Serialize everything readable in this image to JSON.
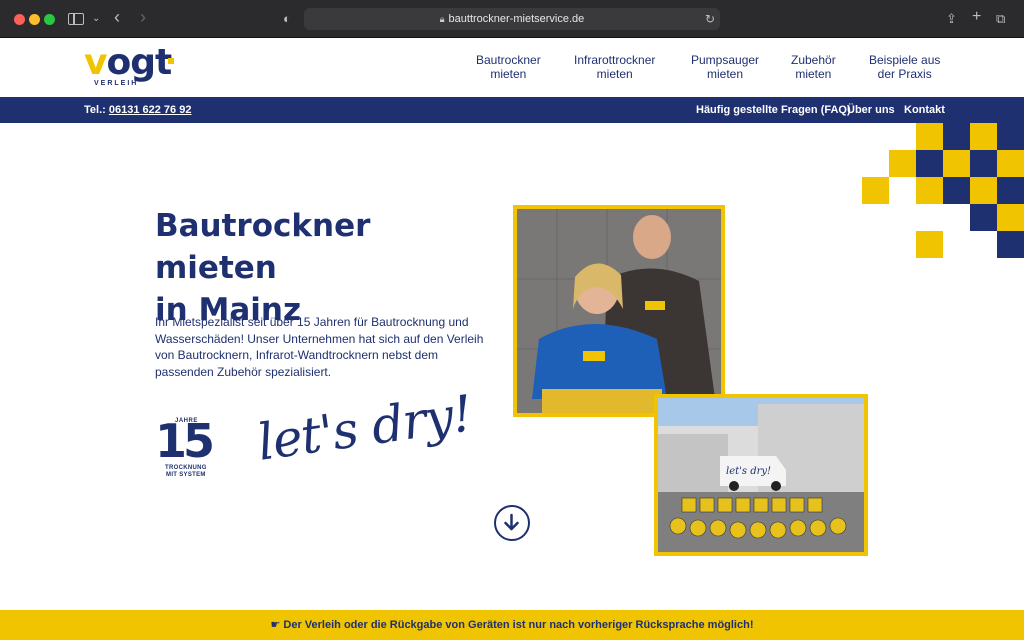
{
  "browser": {
    "url": "bauttrockner-mietservice.de"
  },
  "logo": {
    "brand": "vogt",
    "sub": "VERLEIH"
  },
  "nav": {
    "items": [
      {
        "line1": "Bautrockner",
        "line2": "mieten"
      },
      {
        "line1": "Infrarottrockner",
        "line2": "mieten"
      },
      {
        "line1": "Pumpsauger",
        "line2": "mieten"
      },
      {
        "line1": "Zubehör",
        "line2": "mieten"
      },
      {
        "line1": "Beispiele aus",
        "line2": "der Praxis"
      }
    ]
  },
  "topbar": {
    "phone_label": "Tel.:",
    "phone_number": "06131 622 76 92",
    "links": [
      "Häufig gestellte Fragen (FAQ)",
      "Über uns",
      "Kontakt"
    ]
  },
  "hero": {
    "title_line1": "Bautrockner mieten",
    "title_line2": "in Mainz",
    "text": "Ihr Mietspezialist seit über 15 Jahren für Bautrocknung und Wasserschäden! Unser Unternehmen hat sich auf den Verleih von Bautrocknern, Infrarot-Wandtrocknern nebst dem passenden Zubehör spezialisiert.",
    "badge_number": "15",
    "badge_top": "JAHRE",
    "badge_line1": "TROCKNUNG",
    "badge_line2": "MIT SYSTEM",
    "slogan": "let's dry!"
  },
  "notice": {
    "icon": "pointing-hand-icon",
    "text": "Der Verleih oder die Rückgabe von Geräten ist nur nach vorheriger Rücksprache möglich!"
  },
  "colors": {
    "brand_blue": "#1f3070",
    "brand_yellow": "#f0c400"
  }
}
